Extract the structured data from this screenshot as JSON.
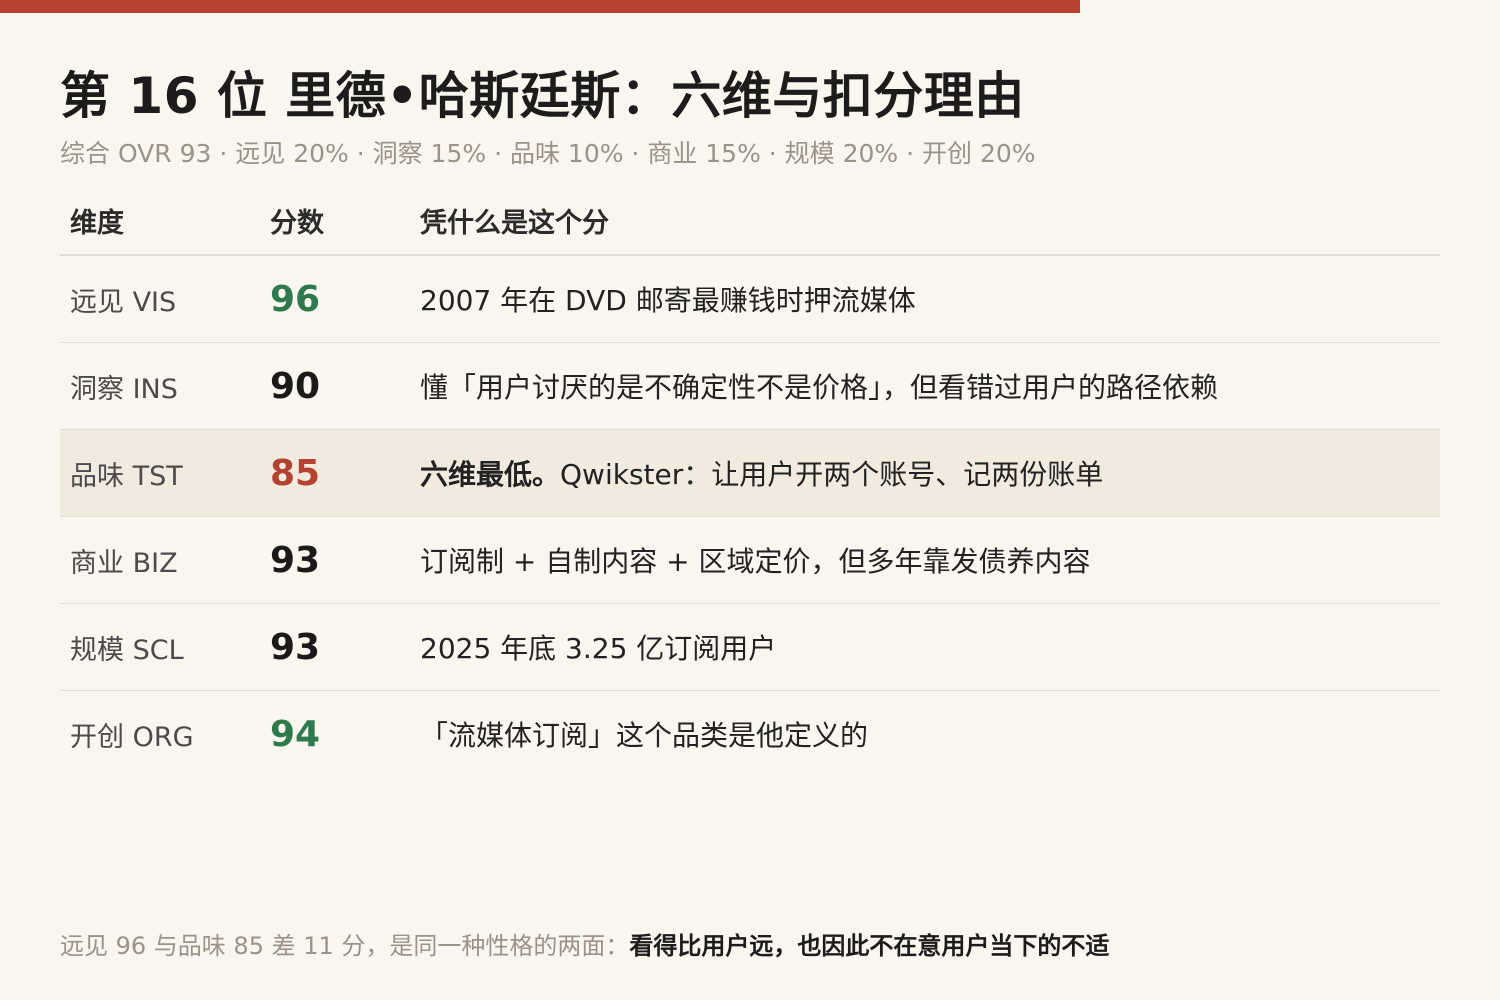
{
  "title": "第 16 位 里德•哈斯廷斯：六维与扣分理由",
  "subtitle": "综合 OVR 93 · 远见 20% · 洞察 15% · 品味 10% · 商业 15% · 规模 20% · 开创 20%",
  "table": {
    "headers": {
      "dimension": "维度",
      "score": "分数",
      "reason": "凭什么是这个分"
    },
    "rows": [
      {
        "dimension": "远见 VIS",
        "score": "96",
        "reason": "2007 年在 DVD 邮寄最赚钱时押流媒体"
      },
      {
        "dimension": "洞察 INS",
        "score": "90",
        "reason": "懂「用户讨厌的是不确定性不是价格」，但看错过用户的路径依赖"
      },
      {
        "dimension": "品味 TST",
        "score": "85",
        "reason_bold": "六维最低。",
        "reason": "Qwikster：让用户开两个账号、记两份账单"
      },
      {
        "dimension": "商业 BIZ",
        "score": "93",
        "reason": "订阅制 + 自制内容 + 区域定价，但多年靠发债养内容"
      },
      {
        "dimension": "规模 SCL",
        "score": "93",
        "reason": "2025 年底 3.25 亿订阅用户"
      },
      {
        "dimension": "开创 ORG",
        "score": "94",
        "reason": "「流媒体订阅」这个品类是他定义的"
      }
    ]
  },
  "footer": {
    "text": "远见 96 与品味 85 差 11 分，是同一种性格的两面：",
    "emphasis": "看得比用户远，也因此不在意用户当下的不适"
  },
  "colors": {
    "accent": "#b54131",
    "score_high": "#2f7a4c",
    "score_low": "#b54131",
    "background": "#f9f6f0",
    "highlight_row": "#f0eadf"
  }
}
